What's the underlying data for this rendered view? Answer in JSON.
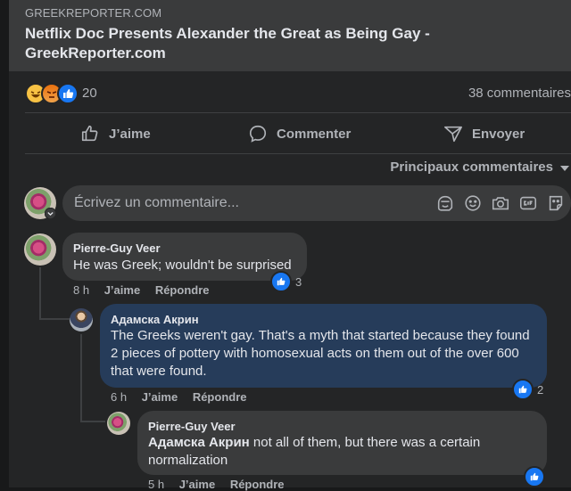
{
  "preview": {
    "domain": "GREEKREPORTER.COM",
    "title": "Netflix Doc Presents Alexander the Great as Being Gay - GreekReporter.com"
  },
  "reactions": {
    "count": "20",
    "comments": "38 commentaires",
    "icons": [
      "haha-icon",
      "angry-icon",
      "like-icon"
    ]
  },
  "actions": {
    "like": "J’aime",
    "comment": "Commenter",
    "send": "Envoyer"
  },
  "sort": {
    "label": "Principaux commentaires"
  },
  "composer": {
    "placeholder": "Écrivez un commentaire..."
  },
  "comments": [
    {
      "author": "Pierre-Guy Veer",
      "text": "He was Greek; wouldn't be surprised",
      "time": "8 h",
      "like": "J’aime",
      "reply": "Répondre",
      "likes": "3"
    },
    {
      "author": "Адамска Акрин",
      "text": "The Greeks weren't gay. That's a myth that started because they found 2 pieces of pottery with homosexual acts on them out of the over 600 that were found.",
      "time": "6 h",
      "like": "J’aime",
      "reply": "Répondre",
      "likes": "2"
    },
    {
      "author": "Pierre-Guy Veer",
      "mention": "Адамска Акрин",
      "text": " not all of them, but there was a certain normalization",
      "time": "5 h",
      "like": "J’aime",
      "reply": "Répondre"
    }
  ],
  "colors": {
    "background": "#18191a",
    "surface": "#242526",
    "bubble": "#3a3b3c",
    "highlighted_bubble": "#263c5a",
    "accent": "#1877f2"
  }
}
